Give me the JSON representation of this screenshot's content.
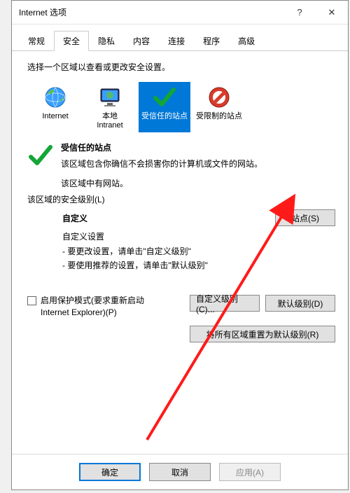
{
  "title": "Internet 选项",
  "tabs": [
    "常规",
    "安全",
    "隐私",
    "内容",
    "连接",
    "程序",
    "高级"
  ],
  "active_tab_index": 1,
  "instruction": "选择一个区域以查看或更改安全设置。",
  "zones": [
    {
      "label": "Internet",
      "icon": "globe"
    },
    {
      "label": "本地\nIntranet",
      "icon": "monitor"
    },
    {
      "label": "受信任的站点",
      "icon": "check"
    },
    {
      "label": "受限制的站点",
      "icon": "no"
    }
  ],
  "selected_zone_index": 2,
  "zone_detail": {
    "title": "受信任的站点",
    "body": "该区域包含你确信不会损害你的计算机或文件的网站。",
    "note": "该区域中有网站。"
  },
  "sites_button": "站点(S)",
  "level_caption": "该区域的安全级别(L)",
  "level": {
    "title": "自定义",
    "lines": [
      "自定义设置",
      "- 要更改设置，请单击\"自定义级别\"",
      "- 要使用推荐的设置，请单击\"默认级别\""
    ]
  },
  "protect_mode_label": "启用保护模式(要求重新启动 Internet Explorer)(P)",
  "buttons": {
    "custom_level": "自定义级别(C)...",
    "default_level": "默认级别(D)",
    "reset_all": "将所有区域重置为默认级别(R)",
    "ok": "确定",
    "cancel": "取消",
    "apply": "应用(A)"
  }
}
